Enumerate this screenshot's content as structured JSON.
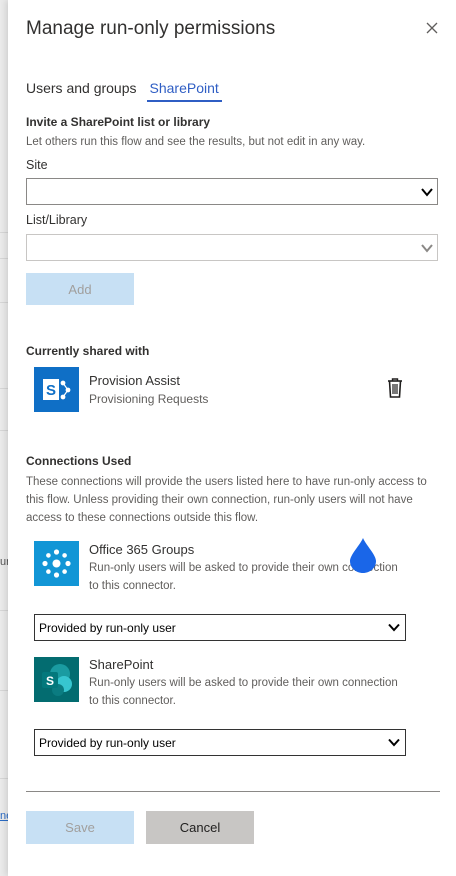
{
  "panel": {
    "title": "Manage run-only permissions",
    "tabs": [
      {
        "label": "Users and groups",
        "active": false
      },
      {
        "label": "SharePoint",
        "active": true
      }
    ]
  },
  "invite": {
    "heading": "Invite a SharePoint list or library",
    "helper": "Let others run this flow and see the results, but not edit in any way.",
    "site_label": "Site",
    "site_value": "",
    "list_label": "List/Library",
    "list_value": "",
    "add_button": "Add"
  },
  "shared": {
    "heading": "Currently shared with",
    "item": {
      "title": "Provision Assist",
      "subtitle": "Provisioning Requests",
      "icon": "sharepoint-icon"
    }
  },
  "connections": {
    "heading": "Connections Used",
    "helper": "These connections will provide the users listed here to have run-only access to this flow. Unless providing their own connection, run-only users will not have access to these connections outside this flow.",
    "items": [
      {
        "title": "Office 365 Groups",
        "description": "Run-only users will be asked to provide their own connection to this connector.",
        "selected": "Provided by run-only user",
        "icon": "office365-groups-icon",
        "color": "#1296d6"
      },
      {
        "title": "SharePoint",
        "description": "Run-only users will be asked to provide their own connection to this connector.",
        "selected": "Provided by run-only user",
        "icon": "sharepoint-icon",
        "color": "#036c70"
      }
    ]
  },
  "footer": {
    "save_label": "Save",
    "cancel_label": "Cancel"
  },
  "backdrop": {
    "fragment_1": "ur",
    "fragment_2": "ne"
  },
  "colors": {
    "accent": "#2f5ec4",
    "disabled_button": "#c7e0f4",
    "sharepoint_blue": "#0f6fc6"
  }
}
